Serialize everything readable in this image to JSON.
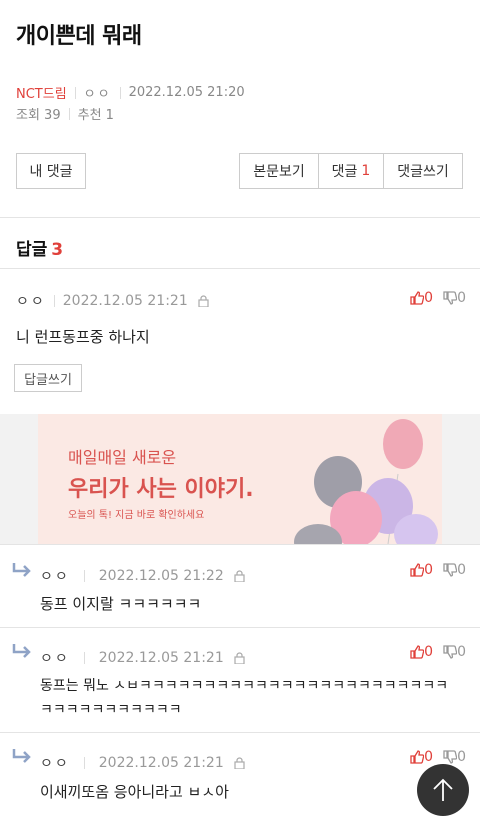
{
  "post": {
    "title": "개이쁜데 뭐래",
    "board": "NCT드림",
    "author": "ㅇㅇ",
    "datetime": "2022.12.05 21:20",
    "views_label": "조회 39",
    "recommend_label": "추천 1"
  },
  "toolbar": {
    "my_comments": "내 댓글",
    "view_post": "본문보기",
    "comments_label": "댓글",
    "comments_count": "1",
    "write_comment": "댓글쓰기"
  },
  "replies_section": {
    "title": "답글",
    "count": "3"
  },
  "comments": [
    {
      "nick": "ㅇㅇ",
      "datetime": "2022.12.05 21:21",
      "up": "0",
      "down": "0",
      "text": "니 런프동프중 하나지",
      "reply_button": "답글쓰기"
    }
  ],
  "ad": {
    "line1": "매일매일 새로운",
    "line2": "우리가 사는 이야기.",
    "line3": "오늘의 톡! 지금 바로 확인하세요"
  },
  "replies": [
    {
      "nick": "ㅇㅇ",
      "datetime": "2022.12.05 21:22",
      "up": "0",
      "down": "0",
      "text": "동프 이지랄 ㅋㅋㅋㅋㅋㅋ"
    },
    {
      "nick": "ㅇㅇ",
      "datetime": "2022.12.05 21:21",
      "up": "0",
      "down": "0",
      "text_line1": "동프는 뭐노 ㅅㅂㅋㅋㅋㅋㅋㅋㅋㅋㅋㅋㅋㅋㅋㅋㅋㅋㅋㅋㅋㅋㅋㅋㅋㅋ",
      "text_line2": "ㅋㅋㅋㅋㅋㅋㅋㅋㅋㅋㅋ"
    },
    {
      "nick": "ㅇㅇ",
      "datetime": "2022.12.05 21:21",
      "up": "0",
      "down": "0",
      "text": "이새끼또옴 응아니라고 ㅂㅅ아"
    }
  ],
  "colors": {
    "accent": "#e0403a",
    "muted": "#999999"
  },
  "icons": {
    "like": "thumbs-up-icon",
    "dislike": "thumbs-down-icon",
    "lock": "lock-icon",
    "reply": "reply-arrow-icon",
    "top": "arrow-up-icon"
  }
}
